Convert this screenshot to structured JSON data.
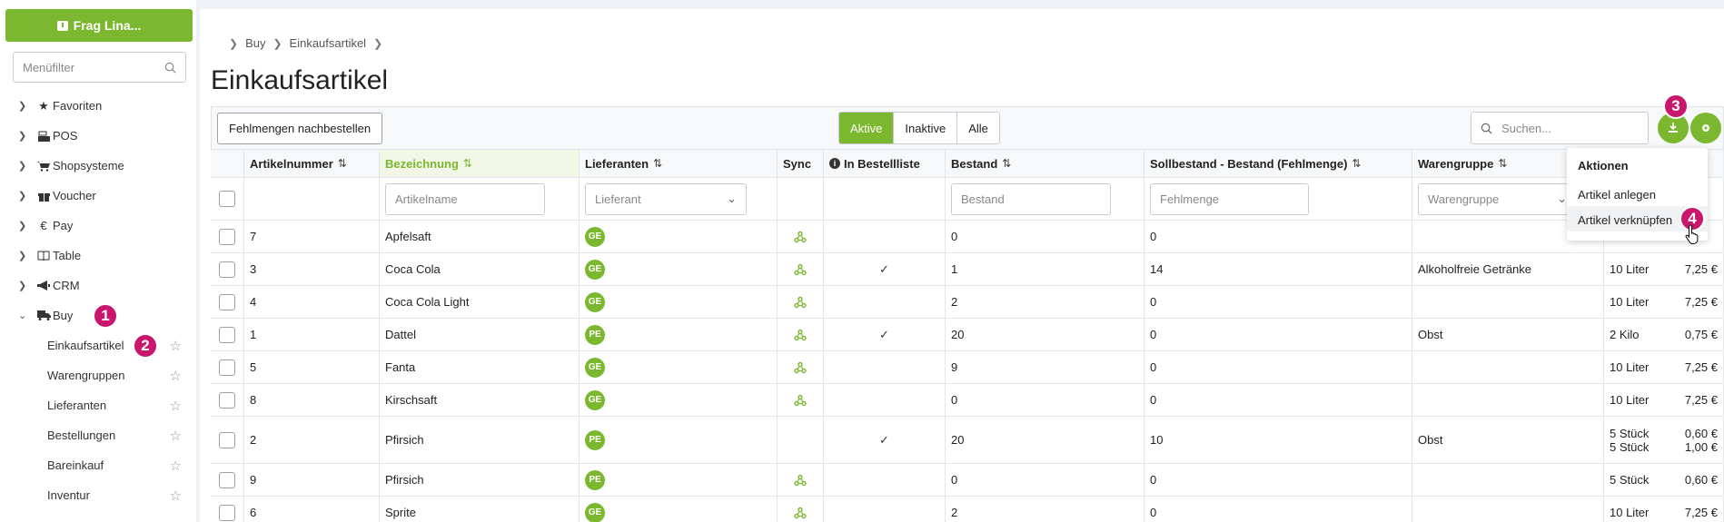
{
  "sidebar": {
    "ask_label": "Frag Lina...",
    "filter_placeholder": "Menüfilter",
    "nav": [
      {
        "label": "Favoriten",
        "icon": "star-icon"
      },
      {
        "label": "POS",
        "icon": "register-icon"
      },
      {
        "label": "Shopsysteme",
        "icon": "cart-icon"
      },
      {
        "label": "Voucher",
        "icon": "gift-icon"
      },
      {
        "label": "Pay",
        "icon": "euro-icon"
      },
      {
        "label": "Table",
        "icon": "book-icon"
      },
      {
        "label": "CRM",
        "icon": "megaphone-icon"
      },
      {
        "label": "Buy",
        "icon": "truck-icon"
      }
    ],
    "buy_sub": [
      "Einkaufsartikel",
      "Warengruppen",
      "Lieferanten",
      "Bestellungen",
      "Bareinkauf",
      "Inventur"
    ]
  },
  "badges": [
    "1",
    "2",
    "3",
    "4"
  ],
  "breadcrumb": [
    "Buy",
    "Einkaufsartikel"
  ],
  "page_title": "Einkaufsartikel",
  "toolbar": {
    "reorder_label": "Fehlmengen nachbestellen",
    "segments": [
      "Aktive",
      "Inaktive",
      "Alle"
    ],
    "active_segment": "Aktive",
    "search_placeholder": "Suchen..."
  },
  "table": {
    "headers": [
      "Artikelnummer",
      "Bezeichnung",
      "Lieferanten",
      "Sync",
      "In Bestellliste",
      "Bestand",
      "Sollbestand - Bestand (Fehlmenge)",
      "Warengruppe"
    ],
    "filters": [
      "Artikelname",
      "Lieferant",
      "Bestand",
      "Fehlmenge",
      "Warengruppe"
    ],
    "rows": [
      {
        "nr": "7",
        "name": "Apfelsaft",
        "supplier": "GE",
        "sync": true,
        "inlist": false,
        "stock": "0",
        "missing": "0",
        "group": "",
        "units": []
      },
      {
        "nr": "3",
        "name": "Coca Cola",
        "supplier": "GE",
        "sync": true,
        "inlist": true,
        "stock": "1",
        "missing": "14",
        "group": "Alkoholfreie Getränke",
        "units": [
          [
            "10 Liter",
            "7,25 €"
          ]
        ]
      },
      {
        "nr": "4",
        "name": "Coca Cola Light",
        "supplier": "GE",
        "sync": true,
        "inlist": false,
        "stock": "2",
        "missing": "0",
        "group": "",
        "units": [
          [
            "10 Liter",
            "7,25 €"
          ]
        ]
      },
      {
        "nr": "1",
        "name": "Dattel",
        "supplier": "PE",
        "sync": true,
        "inlist": true,
        "stock": "20",
        "missing": "0",
        "group": "Obst",
        "units": [
          [
            "2 Kilo",
            "0,75 €"
          ]
        ]
      },
      {
        "nr": "5",
        "name": "Fanta",
        "supplier": "GE",
        "sync": true,
        "inlist": false,
        "stock": "9",
        "missing": "0",
        "group": "",
        "units": [
          [
            "10 Liter",
            "7,25 €"
          ]
        ]
      },
      {
        "nr": "8",
        "name": "Kirschsaft",
        "supplier": "GE",
        "sync": true,
        "inlist": false,
        "stock": "0",
        "missing": "0",
        "group": "",
        "units": [
          [
            "10 Liter",
            "7,25 €"
          ]
        ]
      },
      {
        "nr": "2",
        "name": "Pfirsich",
        "supplier": "PE",
        "sync": false,
        "inlist": true,
        "stock": "20",
        "missing": "10",
        "group": "Obst",
        "units": [
          [
            "5 Stück",
            "0,60 €"
          ],
          [
            "5 Stück",
            "1,00 €"
          ]
        ]
      },
      {
        "nr": "9",
        "name": "Pfirsich",
        "supplier": "PE",
        "sync": true,
        "inlist": false,
        "stock": "0",
        "missing": "0",
        "group": "",
        "units": [
          [
            "5 Stück",
            "0,60 €"
          ]
        ]
      },
      {
        "nr": "6",
        "name": "Sprite",
        "supplier": "GE",
        "sync": true,
        "inlist": false,
        "stock": "2",
        "missing": "0",
        "group": "",
        "units": [
          [
            "10 Liter",
            "7,25 €"
          ]
        ]
      }
    ]
  },
  "dropdown": {
    "title": "Aktionen",
    "items": [
      "Artikel anlegen",
      "Artikel verknüpfen"
    ]
  },
  "colors": {
    "accent": "#7cb82f",
    "badge": "#c8176d"
  }
}
